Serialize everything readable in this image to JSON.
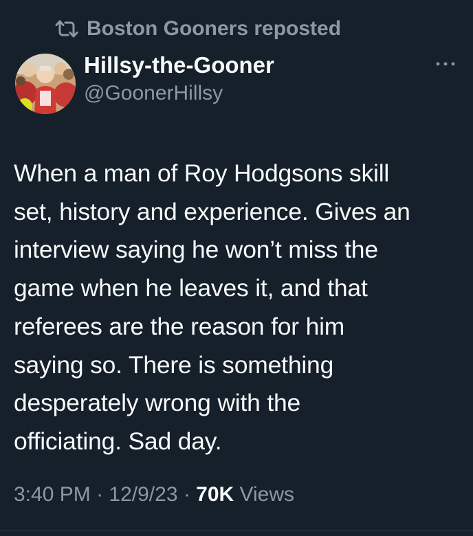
{
  "repost": {
    "icon": "repost-icon",
    "text": "Boston Gooners reposted"
  },
  "author": {
    "avatar_icon": "avatar",
    "display_name": "Hillsy-the-Gooner",
    "handle": "@GoonerHillsy"
  },
  "more_icon": "more-horizontal-icon",
  "tweet": {
    "lines": [
      "When a man of Roy Hodgsons skill",
      "set, history and experience. Gives an",
      "interview saying he won’t miss the",
      "game when he leaves it, and that",
      "referees are the reason for him",
      "saying so. There is something",
      "desperately wrong with the",
      "officiating. Sad day."
    ]
  },
  "meta": {
    "time": "3:40 PM",
    "separator": " · ",
    "date": "12/9/23",
    "views_count": "70K",
    "views_label": " Views"
  },
  "colors": {
    "background": "#15202b",
    "primary_text": "#f7f9f9",
    "secondary_text": "#8b98a5"
  }
}
